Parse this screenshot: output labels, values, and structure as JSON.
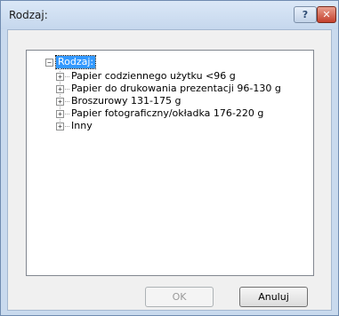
{
  "window": {
    "title": "Rodzaj:",
    "help_label": "?",
    "close_label": "✕"
  },
  "tree": {
    "root_label": "Rodzaj:",
    "root_expander": "−",
    "items": [
      {
        "label": "Papier codziennego użytku <96 g",
        "expander": "+"
      },
      {
        "label": "Papier do drukowania prezentacji 96-130 g",
        "expander": "+"
      },
      {
        "label": "Broszurowy 131-175 g",
        "expander": "+"
      },
      {
        "label": "Papier fotograficzny/okładka 176-220 g",
        "expander": "+"
      },
      {
        "label": "Inny",
        "expander": "+"
      }
    ]
  },
  "buttons": {
    "ok_label": "OK",
    "cancel_label": "Anuluj"
  }
}
